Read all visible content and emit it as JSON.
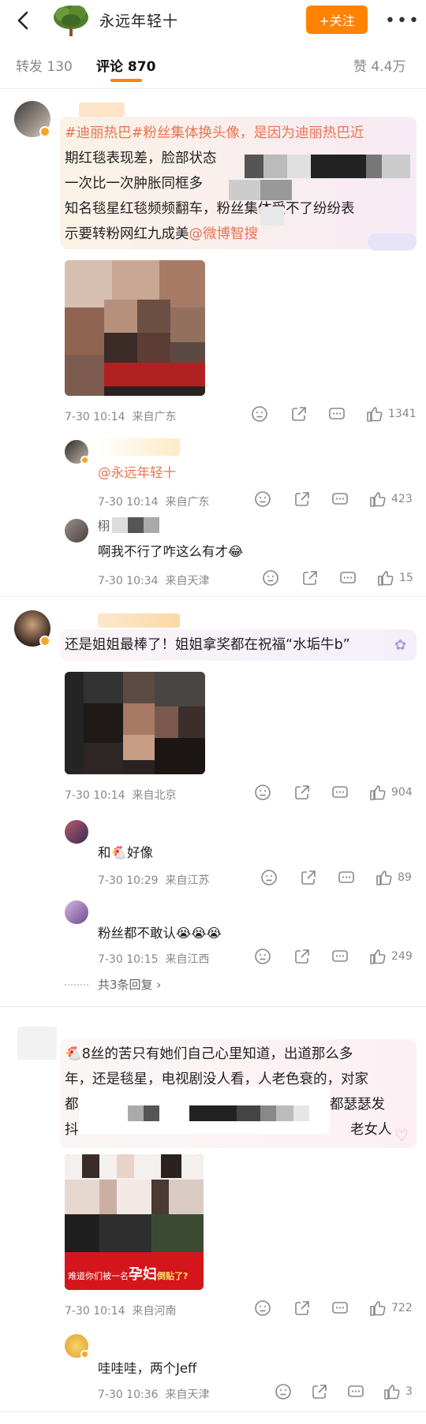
{
  "header": {
    "title": "永远年轻十",
    "follow_label": "+关注",
    "more_label": "•••"
  },
  "tabs": {
    "repost": "转发 130",
    "comments": "评论 870",
    "likes": "赞 4.4万"
  },
  "comments": [
    {
      "text_line1": "#迪丽热巴#粉丝集体换头像，是因为迪丽热巴近",
      "text_line2": "期红毯表现差，脸部状态",
      "text_line3": "一次比一次肿胀同框多",
      "text_line4": "知名毯星红毯频频翻车，粉丝集体受不了纷纷表",
      "text_line5_a": "示要转粉网红九成美",
      "text_line5_mention": "@微博智搜",
      "time": "7-30 10:14",
      "location": "来自广东",
      "likes": "1341",
      "replies": [
        {
          "name": "",
          "text": "@永远年轻十",
          "time": "7-30 10:14",
          "location": "来自广东",
          "likes": "423"
        },
        {
          "name": "栩",
          "text": "啊我不行了咋这么有才😂",
          "time": "7-30 10:34",
          "location": "来自天津",
          "likes": "15"
        }
      ]
    },
    {
      "text": "还是姐姐最棒了！姐姐拿奖都在祝福“水垢牛b”",
      "time": "7-30 10:14",
      "location": "来自北京",
      "likes": "904",
      "replies": [
        {
          "text": "和🐔好像",
          "time": "7-30 10:29",
          "location": "来自江苏",
          "likes": "89"
        },
        {
          "text": "粉丝都不敢认😭😭😭",
          "time": "7-30 10:15",
          "location": "来自江西",
          "likes": "249"
        }
      ],
      "more_replies": "共3条回复 ›"
    },
    {
      "text_line1": "🐔8丝的苦只有她们自己心里知道，出道那么多",
      "text_line2": "年，还是毯星，电视剧没人看，人老色衰的，对家",
      "text_line3": "都",
      "text_line3_end": "都瑟瑟发",
      "text_line4": "抖",
      "text_line4_end": "老女人",
      "image_caption_a": "难道你们被一名",
      "image_caption_b": "孕妇",
      "image_caption_c": "倒贴了?",
      "time": "7-30 10:14",
      "location": "来自河南",
      "likes": "722",
      "replies": [
        {
          "text": "哇哇哇，两个Jeff",
          "time": "7-30 10:36",
          "location": "来自天津",
          "likes": "3"
        }
      ]
    }
  ],
  "colors": {
    "accent": "#ff8200",
    "link": "#eb7350",
    "meta": "#888888"
  }
}
